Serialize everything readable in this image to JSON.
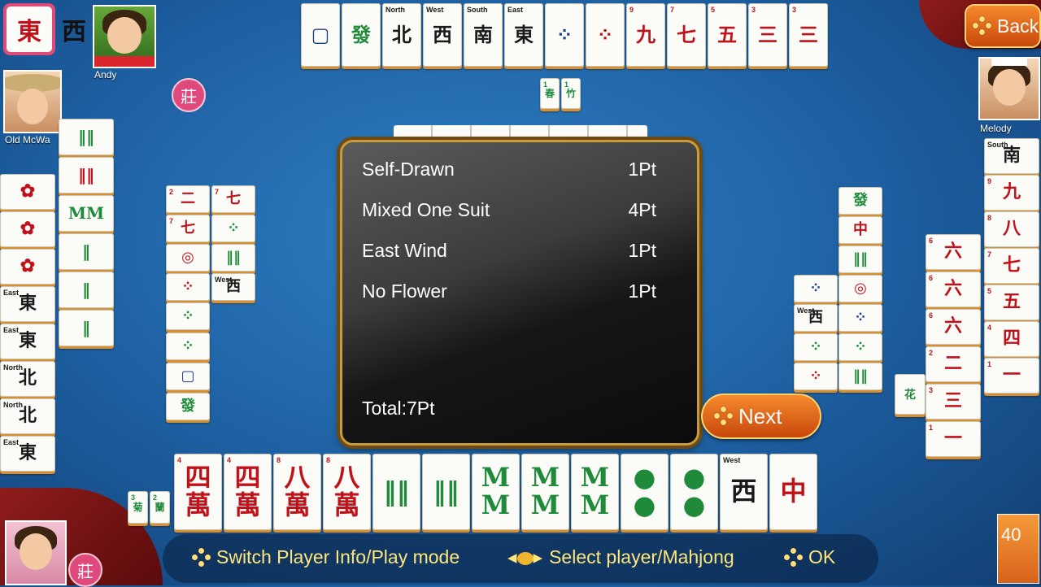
{
  "round": {
    "seat_wind": "東",
    "prevalent_wind": "西"
  },
  "buttons": {
    "back_label": "Back",
    "next_label": "Next"
  },
  "players": {
    "top": {
      "name": "Andy"
    },
    "left": {
      "name": "Old McWa"
    },
    "right": {
      "name": "Melody"
    },
    "bottom": {
      "name": ""
    }
  },
  "dealer_badge": "莊",
  "score": {
    "items": [
      {
        "name": "Self-Drawn",
        "points": "1Pt"
      },
      {
        "name": "Mixed One Suit",
        "points": "4Pt"
      },
      {
        "name": "East Wind",
        "points": "1Pt"
      },
      {
        "name": "No Flower",
        "points": "1Pt"
      }
    ],
    "total": "Total:7Pt"
  },
  "hints": {
    "switch": "Switch Player Info/Play mode",
    "select": "Select player/Mahjong",
    "ok": "OK"
  },
  "tiles_left": "40",
  "hand_tiles": [
    {
      "glyph": "四\n萬",
      "num": "4",
      "suit": "red"
    },
    {
      "glyph": "四\n萬",
      "num": "4",
      "suit": "red"
    },
    {
      "glyph": "八\n萬",
      "num": "8",
      "suit": "red"
    },
    {
      "glyph": "八\n萬",
      "num": "8",
      "suit": "red"
    },
    {
      "glyph": "‖‖",
      "num": "",
      "suit": "green"
    },
    {
      "glyph": "‖‖",
      "num": "",
      "suit": "green"
    },
    {
      "glyph": "M\nM",
      "num": "",
      "suit": "green"
    },
    {
      "glyph": "M\nM",
      "num": "",
      "suit": "green"
    },
    {
      "glyph": "M\nM",
      "num": "",
      "suit": "green"
    },
    {
      "glyph": "●\n●",
      "num": "",
      "suit": "green"
    },
    {
      "glyph": "●\n●",
      "num": "",
      "suit": "green"
    },
    {
      "glyph": "西",
      "num": "West",
      "suit": "black"
    },
    {
      "glyph": "中",
      "num": "",
      "suit": "red"
    }
  ],
  "top_tiles": [
    {
      "glyph": "▢",
      "suit": "blue",
      "num": ""
    },
    {
      "glyph": "發",
      "suit": "green",
      "num": ""
    },
    {
      "glyph": "北",
      "suit": "black",
      "num": "North"
    },
    {
      "glyph": "西",
      "suit": "black",
      "num": "West"
    },
    {
      "glyph": "南",
      "suit": "black",
      "num": "South"
    },
    {
      "glyph": "東",
      "suit": "black",
      "num": "East"
    },
    {
      "glyph": "⁘",
      "suit": "blue",
      "num": ""
    },
    {
      "glyph": "⁘",
      "suit": "red",
      "num": ""
    },
    {
      "glyph": "九",
      "suit": "red",
      "num": "9"
    },
    {
      "glyph": "七",
      "suit": "red",
      "num": "7"
    },
    {
      "glyph": "五",
      "suit": "red",
      "num": "5"
    },
    {
      "glyph": "三",
      "suit": "red",
      "num": "3"
    },
    {
      "glyph": "三",
      "suit": "red",
      "num": "3"
    }
  ],
  "right_tiles": [
    {
      "glyph": "南",
      "suit": "black",
      "num": "South"
    },
    {
      "glyph": "九",
      "suit": "red",
      "num": "9"
    },
    {
      "glyph": "八",
      "suit": "red",
      "num": "8"
    },
    {
      "glyph": "七",
      "suit": "red",
      "num": "7"
    },
    {
      "glyph": "五",
      "suit": "red",
      "num": "5"
    },
    {
      "glyph": "四",
      "suit": "red",
      "num": "4"
    },
    {
      "glyph": "一",
      "suit": "red",
      "num": "1"
    }
  ],
  "right_meld": [
    {
      "glyph": "六",
      "suit": "red",
      "num": "6"
    },
    {
      "glyph": "六",
      "suit": "red",
      "num": "6"
    },
    {
      "glyph": "六",
      "suit": "red",
      "num": "6"
    },
    {
      "glyph": "二",
      "suit": "red",
      "num": "2"
    },
    {
      "glyph": "三",
      "suit": "red",
      "num": "3"
    },
    {
      "glyph": "一",
      "suit": "red",
      "num": "1"
    }
  ],
  "left_tiles": [
    {
      "glyph": "✿",
      "suit": "red",
      "num": ""
    },
    {
      "glyph": "✿",
      "suit": "red",
      "num": ""
    },
    {
      "glyph": "✿",
      "suit": "red",
      "num": ""
    },
    {
      "glyph": "東",
      "suit": "black",
      "num": "East"
    },
    {
      "glyph": "東",
      "suit": "black",
      "num": "East"
    },
    {
      "glyph": "北",
      "suit": "black",
      "num": "North"
    },
    {
      "glyph": "北",
      "suit": "black",
      "num": "North"
    },
    {
      "glyph": "東",
      "suit": "black",
      "num": "East"
    }
  ],
  "left_meld": [
    {
      "glyph": "‖‖",
      "suit": "green",
      "num": ""
    },
    {
      "glyph": "‖‖",
      "suit": "red",
      "num": ""
    },
    {
      "glyph": "MM",
      "suit": "green",
      "num": ""
    },
    {
      "glyph": "‖",
      "suit": "green",
      "num": ""
    },
    {
      "glyph": "‖",
      "suit": "green",
      "num": ""
    },
    {
      "glyph": "‖",
      "suit": "green",
      "num": ""
    }
  ],
  "left_discards": [
    {
      "glyph": "二",
      "suit": "red",
      "num": "2"
    },
    {
      "glyph": "七",
      "suit": "red",
      "num": "7"
    },
    {
      "glyph": "七",
      "suit": "red",
      "num": "7"
    },
    {
      "glyph": "⁘",
      "suit": "green",
      "num": ""
    },
    {
      "glyph": "◎",
      "suit": "red",
      "num": ""
    },
    {
      "glyph": "‖‖",
      "suit": "green",
      "num": ""
    },
    {
      "glyph": "⁘",
      "suit": "red",
      "num": ""
    },
    {
      "glyph": "西",
      "suit": "black",
      "num": "West"
    },
    {
      "glyph": "⁘",
      "suit": "green",
      "num": ""
    },
    {
      "glyph": "⁘",
      "suit": "green",
      "num": ""
    },
    {
      "glyph": "▢",
      "suit": "blue",
      "num": ""
    },
    {
      "glyph": "發",
      "suit": "green",
      "num": ""
    }
  ],
  "right_discards": [
    {
      "glyph": "發",
      "suit": "green",
      "num": ""
    },
    {
      "glyph": "中",
      "suit": "red",
      "num": ""
    },
    {
      "glyph": "‖‖",
      "suit": "green",
      "num": ""
    },
    {
      "glyph": "⁘",
      "suit": "red",
      "num": ""
    },
    {
      "glyph": "⁘",
      "suit": "blue",
      "num": ""
    },
    {
      "glyph": "◎",
      "suit": "red",
      "num": ""
    },
    {
      "glyph": "西",
      "suit": "black",
      "num": "West"
    },
    {
      "glyph": "⁘",
      "suit": "blue",
      "num": ""
    },
    {
      "glyph": "⁘",
      "suit": "green",
      "num": ""
    },
    {
      "glyph": "⁘",
      "suit": "green",
      "num": ""
    },
    {
      "glyph": "⁘",
      "suit": "red",
      "num": ""
    },
    {
      "glyph": "‖‖",
      "suit": "green",
      "num": ""
    }
  ],
  "flowers_bottom": [
    {
      "glyph": "菊",
      "num": "3"
    },
    {
      "glyph": "蘭",
      "num": "2"
    }
  ],
  "flowers_top": [
    {
      "glyph": "春",
      "num": "1"
    },
    {
      "glyph": "竹",
      "num": "1"
    }
  ],
  "colors": {
    "panel_border": "#c99b3a",
    "accent_orange": "#e8661b",
    "table_blue": "#1c5d9e",
    "hint_yellow": "#ffe67a"
  }
}
